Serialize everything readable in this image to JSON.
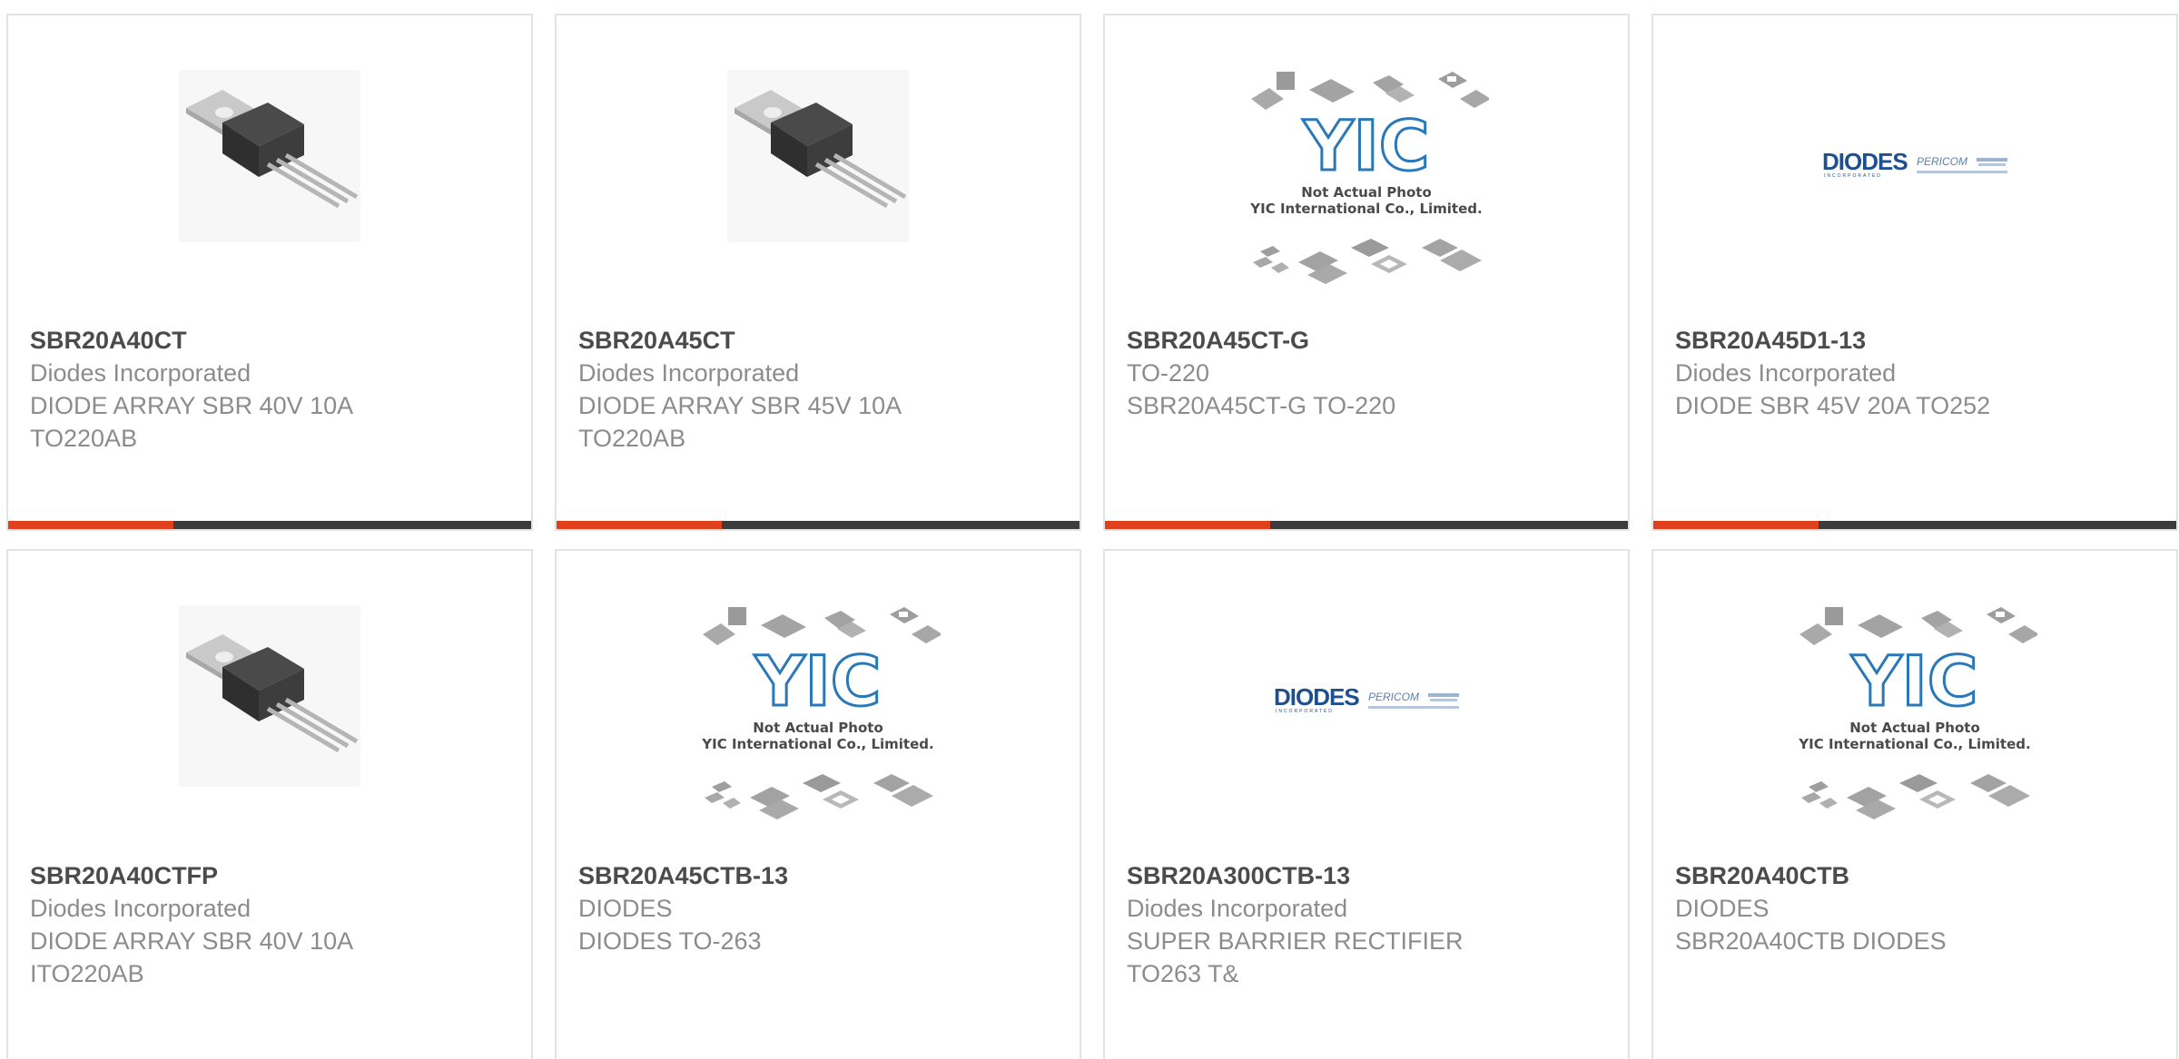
{
  "products": [
    {
      "part_number": "SBR20A40CT",
      "manufacturer": "Diodes Incorporated",
      "desc_line1": "DIODE ARRAY SBR 40V 10A",
      "desc_line2": "TO220AB",
      "image": "to220-package"
    },
    {
      "part_number": "SBR20A45CT",
      "manufacturer": "Diodes Incorporated",
      "desc_line1": "DIODE ARRAY SBR 45V 10A",
      "desc_line2": "TO220AB",
      "image": "to220-package"
    },
    {
      "part_number": "SBR20A45CT-G",
      "manufacturer": "TO-220",
      "desc_line1": "SBR20A45CT-G TO-220",
      "desc_line2": "",
      "image": "yic-placeholder"
    },
    {
      "part_number": "SBR20A45D1-13",
      "manufacturer": "Diodes Incorporated",
      "desc_line1": "DIODE SBR 45V 20A TO252",
      "desc_line2": "",
      "image": "diodes-pericom-logo"
    },
    {
      "part_number": "SBR20A40CTFP",
      "manufacturer": "Diodes Incorporated",
      "desc_line1": "DIODE ARRAY SBR 40V 10A",
      "desc_line2": "ITO220AB",
      "image": "to220-package"
    },
    {
      "part_number": "SBR20A45CTB-13",
      "manufacturer": "DIODES",
      "desc_line1": "DIODES TO-263",
      "desc_line2": "",
      "image": "yic-placeholder"
    },
    {
      "part_number": "SBR20A300CTB-13",
      "manufacturer": "Diodes Incorporated",
      "desc_line1": "SUPER BARRIER RECTIFIER",
      "desc_line2": "TO263 T&",
      "image": "diodes-pericom-logo"
    },
    {
      "part_number": "SBR20A40CTB",
      "manufacturer": "DIODES",
      "desc_line1": "SBR20A40CTB DIODES",
      "desc_line2": "",
      "image": "yic-placeholder"
    }
  ],
  "placeholder": {
    "logo_text": "YIC",
    "line1": "Not Actual Photo",
    "line2": "YIC International Co., Limited."
  },
  "diodes_logo": {
    "brand": "DIODES",
    "sub": "INCORPORATED",
    "partner": "PERICOM"
  },
  "colors": {
    "accent": "#e0411c",
    "bar": "#3c3c3c",
    "title": "#4b4b4b",
    "text": "#8c8c8c"
  }
}
